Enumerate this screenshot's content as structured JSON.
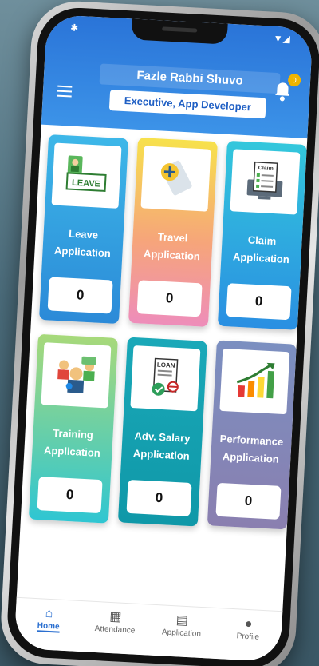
{
  "header": {
    "name": "Fazle Rabbi Shuvo",
    "role": "Executive, App Developer",
    "notification_count": "0"
  },
  "cards": [
    {
      "title_line1": "Leave",
      "title_line2": "Application",
      "count": "0",
      "icon": "leave-icon"
    },
    {
      "title_line1": "Travel",
      "title_line2": "Application",
      "count": "0",
      "icon": "travel-icon"
    },
    {
      "title_line1": "Claim",
      "title_line2": "Application",
      "count": "0",
      "icon": "claim-icon"
    },
    {
      "title_line1": "Training",
      "title_line2": "Application",
      "count": "0",
      "icon": "training-icon"
    },
    {
      "title_line1": "Adv. Salary",
      "title_line2": "Application",
      "count": "0",
      "icon": "loan-icon"
    },
    {
      "title_line1": "Performance",
      "title_line2": "Application",
      "count": "0",
      "icon": "performance-chart-icon"
    }
  ],
  "icon_labels": {
    "leave": "LEAVE",
    "claim": "Claim",
    "loan": "LOAN"
  },
  "nav": [
    {
      "label": "Home",
      "icon": "home-icon"
    },
    {
      "label": "Attendance",
      "icon": "calendar-icon"
    },
    {
      "label": "Application",
      "icon": "document-icon"
    },
    {
      "label": "Profile",
      "icon": "user-icon"
    }
  ],
  "colors": {
    "header_blue": "#2a74d8",
    "active_nav": "#2a6fd0"
  }
}
